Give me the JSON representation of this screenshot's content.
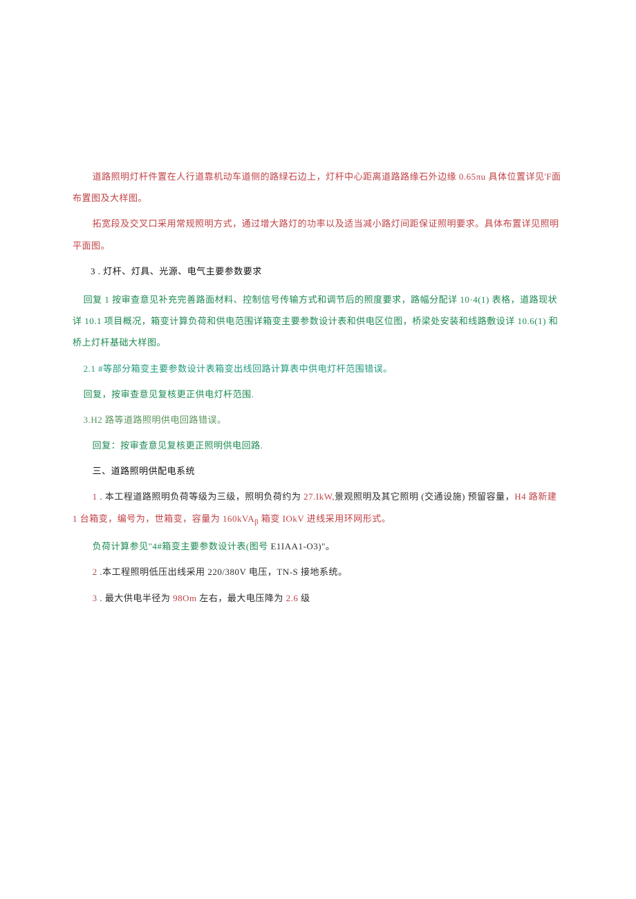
{
  "paras": {
    "p1": {
      "a": "道路照明灯杆件置在人行道靠机动车道侧的路绿石边上，灯杆中心距离道路路缘石外边缘 ",
      "b": "0.65πu",
      "c": " 具体位置详见'F面布置图及大样图。"
    },
    "p2": "拓宽段及交叉口采用常规照明方式，通过增大路灯的功率以及适当减小路灯间距保证照明要求。具体布置详见照明平面图。",
    "p3": {
      "num": "3",
      "text": " . 灯杆、灯具、光源、电气主要参数要求"
    },
    "p4": {
      "a": "回复 1 按审查意见补充完善路面材料、控制信号传输方式和调节后的照度要求，路幅分配详 ",
      "b": "10·4(1)",
      "c": " 表格，道路现状详 ",
      "d": "10.1",
      "e": " 项目概况，箱变计算负荷和供电范围详箱变主要参数设计表和供电区位图，桥梁处安装和线路敷设详 ",
      "f": "10.6(1)",
      "g": " 和桥上灯杆基础大样图。"
    },
    "p5": {
      "a": "2.1",
      "b": "    #等部分箱变主要参数设计表箱变出线回路计算表中供电灯杆范围错误。"
    },
    "p6": "回复，按审查意见复核更正供电灯杆范围.",
    "p7": {
      "a": "3.H2",
      "b": " 路等道路照明供电回路错误。"
    },
    "p8": "回复：按审查意见复核更正照明供电回路.",
    "p9": "三、道路照明供配电系统",
    "p10": {
      "a": "1",
      "b": " . 本工程道路照明负荷等级为三级，照明负荷约为 ",
      "c": "27.IkW,",
      "d": "景观照明及其它照明 (交通设施) 预留容量，",
      "e": "H4",
      "f": " 路新建 1 台箱变，编号为，世箱变，容量为 ",
      "g": "160kVA",
      "h": "β",
      "i": " 箱变 ",
      "j": "IOkV",
      "k": " 进线采用环网形式。"
    },
    "p11": {
      "a": "负荷计算参见\"4#箱变主要参数设计表(图号 ",
      "b": "E1IAA1-O3)\"。"
    },
    "p12": {
      "a": "2",
      "b": "        .本工程照明低压出线采用 ",
      "c": "220/380V",
      "d": " 电压，",
      "e": "TN-S",
      "f": " 接地系统。"
    },
    "p13": {
      "a": "3",
      "b": "        . 最大供电半径为 ",
      "c": "98Om",
      "d": " 左右，最大电压降为 ",
      "e": "2.6",
      "f": " 级"
    }
  },
  "colors": {
    "red": "#c04246",
    "green": "#1c8a52",
    "teal": "#1e9a7a",
    "dkgreen": "#5a945c"
  }
}
